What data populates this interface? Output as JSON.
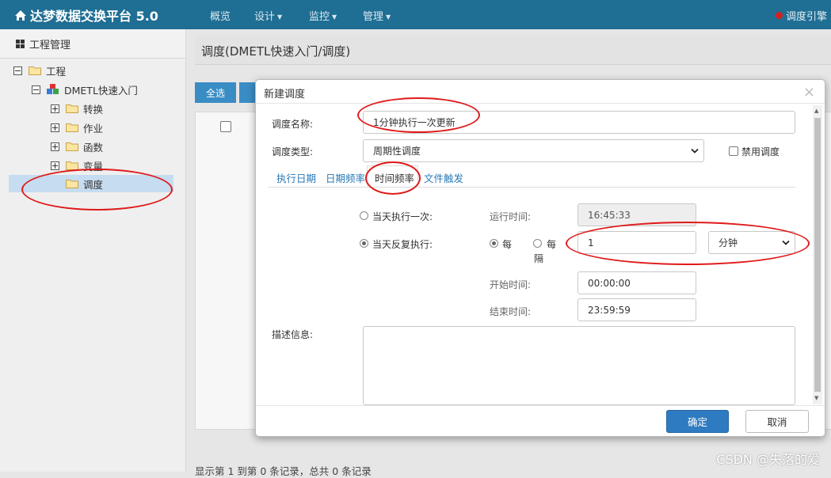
{
  "app": {
    "title": "达梦数据交换平台 5.0",
    "engine_label": "调度引擎",
    "colors": {
      "topbar": "#1f6e94",
      "accent": "#2f7bc1",
      "annotation": "#e01a1a"
    }
  },
  "nav": {
    "items": [
      "概览",
      "设计",
      "监控",
      "管理"
    ]
  },
  "sidebar": {
    "header": "工程管理",
    "tree": {
      "root": "工程",
      "project": "DMETL快速入门",
      "children": [
        "转换",
        "作业",
        "函数",
        "变量",
        "调度"
      ],
      "selected": "调度"
    }
  },
  "main": {
    "breadcrumb": "调度(DMETL快速入门/调度)",
    "select_all_label": "全选",
    "footer": "显示第 1 到第 0 条记录，总共 0 条记录"
  },
  "modal": {
    "title": "新建调度",
    "name_label": "调度名称:",
    "name_value": "1分钟执行一次更新",
    "type_label": "调度类型:",
    "type_value": "周期性调度",
    "disable_label": "禁用调度",
    "tabs": [
      "执行日期",
      "日期频率",
      "时间频率",
      "文件触发"
    ],
    "active_tab": "时间频率",
    "once_label": "当天执行一次:",
    "run_time_label": "运行时间:",
    "run_time_value": "16:45:33",
    "repeat_label": "当天反复执行:",
    "every_label": "每",
    "every_interval_label_1": "每",
    "every_interval_label_2": "隔",
    "interval_value": "1",
    "unit_value": "分钟",
    "start_label": "开始时间:",
    "start_value": "00:00:00",
    "end_label": "结束时间:",
    "end_value": "23:59:59",
    "desc_label": "描述信息:",
    "ok_label": "确定",
    "cancel_label": "取消"
  },
  "watermark": "CSDN @失落的爱"
}
